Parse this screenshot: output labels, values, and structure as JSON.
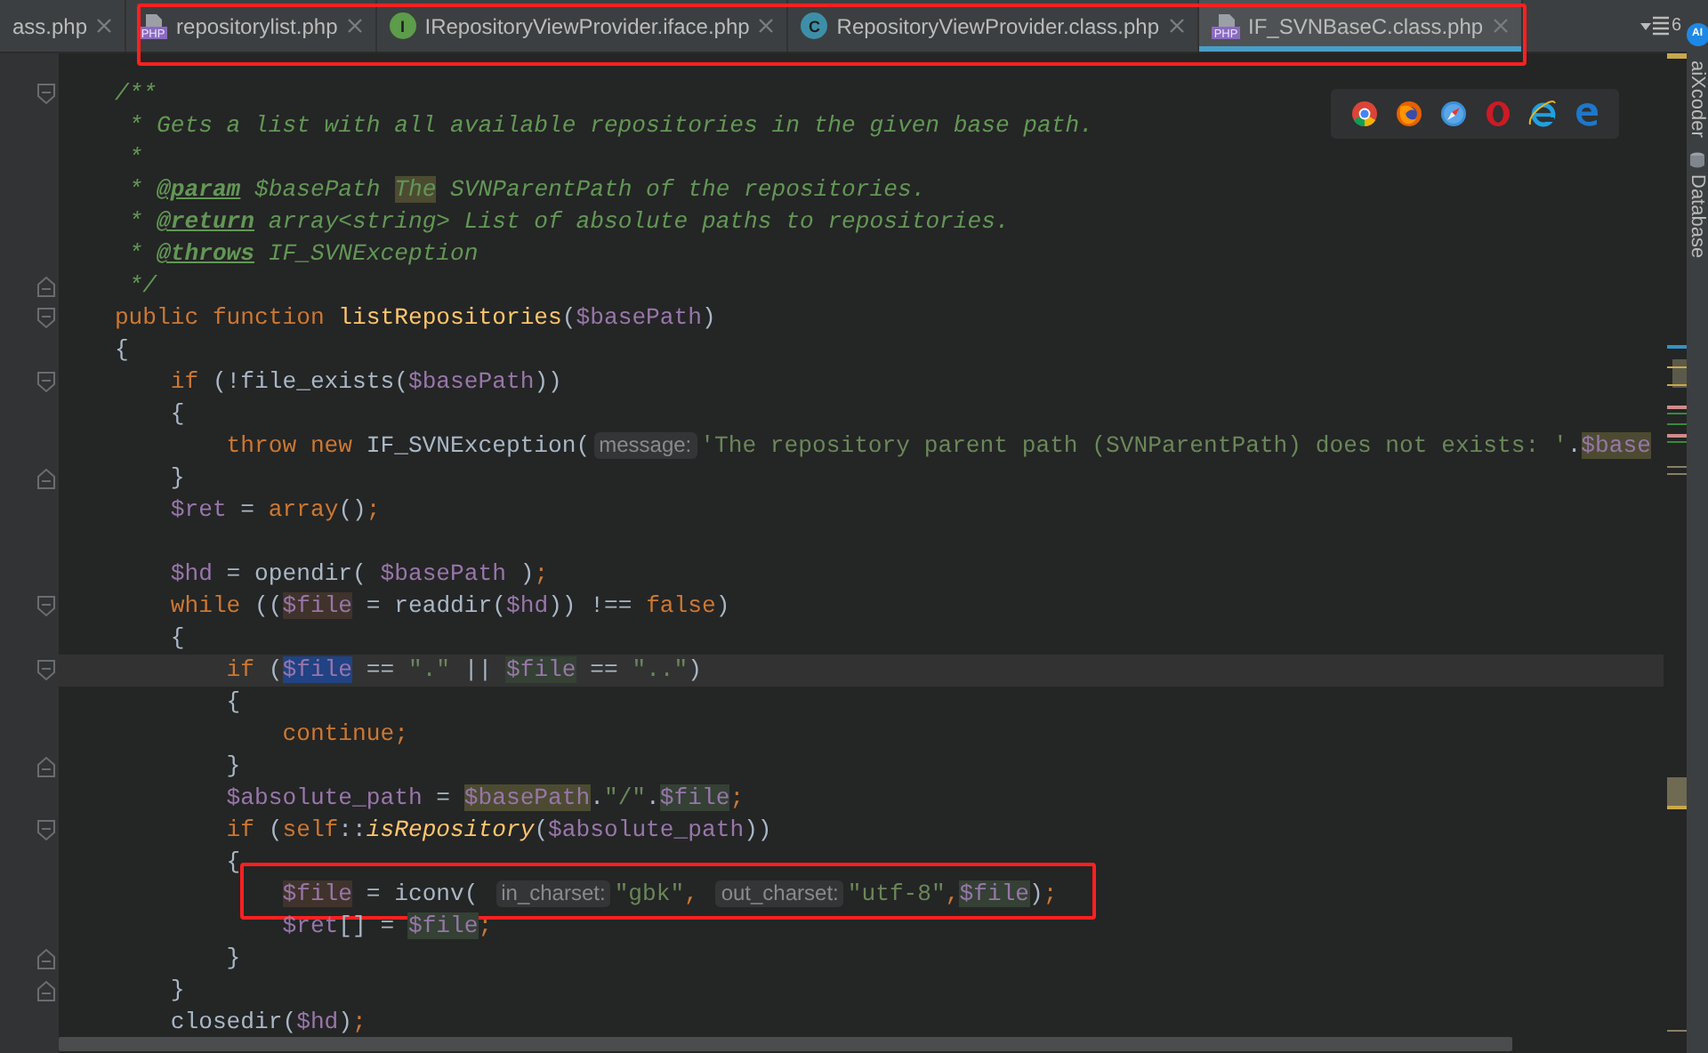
{
  "tab_bar": {
    "tabs": [
      {
        "label": "ass.php",
        "selected": false,
        "boxed": false
      },
      {
        "label": "repositorylist.php",
        "selected": false,
        "boxed": true,
        "icon": {
          "kind": "php-file",
          "label": "PHP"
        }
      },
      {
        "label": "IRepositoryViewProvider.iface.php",
        "selected": false,
        "boxed": true,
        "icon": {
          "kind": "interface",
          "label": "I"
        }
      },
      {
        "label": "RepositoryViewProvider.class.php",
        "selected": false,
        "boxed": true,
        "icon": {
          "kind": "class",
          "label": "C"
        }
      },
      {
        "label": "IF_SVNBaseC.class.php",
        "selected": true,
        "boxed": true,
        "icon": {
          "kind": "php-file",
          "label": "PHP"
        }
      }
    ],
    "overflow_count": "6"
  },
  "browser_bar": [
    {
      "kind": "chrome"
    },
    {
      "kind": "firefox"
    },
    {
      "kind": "safari"
    },
    {
      "kind": "opera"
    },
    {
      "kind": "ie"
    },
    {
      "kind": "edge"
    }
  ],
  "code_lines": [
    {
      "fold_start": true,
      "tokens": [
        {
          "kind": "doc",
          "text": "    /**"
        }
      ]
    },
    {
      "tokens": [
        {
          "kind": "doc",
          "text": "     * Gets a list with all available repositories in the given base path."
        }
      ]
    },
    {
      "tokens": [
        {
          "kind": "doc",
          "text": "     *"
        }
      ]
    },
    {
      "tokens": [
        {
          "kind": "doc",
          "text": "     * "
        },
        {
          "kind": "doctag",
          "text": "@param"
        },
        {
          "kind": "doc",
          "text": " $basePath "
        },
        {
          "kind": "doc-typo",
          "text": "The"
        },
        {
          "kind": "doc",
          "text": " SVNParentPath of the repositories."
        }
      ]
    },
    {
      "tokens": [
        {
          "kind": "doc",
          "text": "     * "
        },
        {
          "kind": "doctag",
          "text": "@return"
        },
        {
          "kind": "doc",
          "text": " array<string> List of absolute paths to repositories."
        }
      ]
    },
    {
      "tokens": [
        {
          "kind": "doc",
          "text": "     * "
        },
        {
          "kind": "doctag",
          "text": "@throws"
        },
        {
          "kind": "doc",
          "text": " IF_SVNException"
        }
      ]
    },
    {
      "fold_end": true,
      "tokens": [
        {
          "kind": "doc",
          "text": "     */"
        }
      ]
    },
    {
      "fold_start": true,
      "tokens": [
        {
          "kind": "kw",
          "text": "    public function "
        },
        {
          "kind": "fn",
          "text": "listRepositories"
        },
        {
          "kind": "plain",
          "text": "("
        },
        {
          "kind": "var",
          "text": "$basePath"
        },
        {
          "kind": "plain",
          "text": ")"
        }
      ]
    },
    {
      "tokens": [
        {
          "kind": "plain",
          "text": "    {"
        }
      ]
    },
    {
      "fold_start": true,
      "tokens": [
        {
          "kind": "kw",
          "text": "        if"
        },
        {
          "kind": "plain",
          "text": " (!file_exists("
        },
        {
          "kind": "var",
          "text": "$basePath"
        },
        {
          "kind": "plain",
          "text": "))"
        }
      ]
    },
    {
      "tokens": [
        {
          "kind": "plain",
          "text": "        {"
        }
      ]
    },
    {
      "tokens": [
        {
          "kind": "kw",
          "text": "            throw new "
        },
        {
          "kind": "plain",
          "text": "IF_SVNException("
        },
        {
          "kind": "hint",
          "text": "message:"
        },
        {
          "kind": "str",
          "text": "'The repository parent path (SVNParentPath) does not exists: '"
        },
        {
          "kind": "plain",
          "text": "."
        },
        {
          "kind": "var-search",
          "text": "$base"
        }
      ]
    },
    {
      "fold_end": true,
      "tokens": [
        {
          "kind": "plain",
          "text": "        }"
        }
      ]
    },
    {
      "tokens": [
        {
          "kind": "var",
          "text": "        $ret"
        },
        {
          "kind": "plain",
          "text": " = "
        },
        {
          "kind": "kw",
          "text": "array"
        },
        {
          "kind": "plain",
          "text": "()"
        },
        {
          "kind": "kw",
          "text": ";"
        }
      ]
    },
    {
      "blank": true
    },
    {
      "tokens": [
        {
          "kind": "var",
          "text": "        $hd"
        },
        {
          "kind": "plain",
          "text": " = opendir( "
        },
        {
          "kind": "var",
          "text": "$basePath"
        },
        {
          "kind": "plain",
          "text": " )"
        },
        {
          "kind": "kw",
          "text": ";"
        }
      ]
    },
    {
      "fold_start": true,
      "tokens": [
        {
          "kind": "kw",
          "text": "        while"
        },
        {
          "kind": "plain",
          "text": " (("
        },
        {
          "kind": "var-write",
          "text": "$file"
        },
        {
          "kind": "plain",
          "text": " = readdir("
        },
        {
          "kind": "var",
          "text": "$hd"
        },
        {
          "kind": "plain",
          "text": ")) !== "
        },
        {
          "kind": "kw",
          "text": "false"
        },
        {
          "kind": "plain",
          "text": ")"
        }
      ]
    },
    {
      "tokens": [
        {
          "kind": "plain",
          "text": "        {"
        }
      ]
    },
    {
      "fold_start": true,
      "current": true,
      "tokens": [
        {
          "kind": "kw",
          "text": "            if"
        },
        {
          "kind": "plain",
          "text": " ("
        },
        {
          "kind": "var-caret",
          "text": "$file"
        },
        {
          "kind": "plain",
          "text": " == "
        },
        {
          "kind": "str",
          "text": "\".\""
        },
        {
          "kind": "plain",
          "text": " || "
        },
        {
          "kind": "var-read",
          "text": "$file"
        },
        {
          "kind": "plain",
          "text": " == "
        },
        {
          "kind": "str",
          "text": "\"..\""
        },
        {
          "kind": "plain",
          "text": ")"
        }
      ]
    },
    {
      "tokens": [
        {
          "kind": "plain",
          "text": "            {"
        }
      ]
    },
    {
      "tokens": [
        {
          "kind": "kw",
          "text": "                continue;"
        }
      ]
    },
    {
      "fold_end": true,
      "tokens": [
        {
          "kind": "plain",
          "text": "            }"
        }
      ]
    },
    {
      "tokens": [
        {
          "kind": "var",
          "text": "            $absolute_path"
        },
        {
          "kind": "plain",
          "text": " = "
        },
        {
          "kind": "var-search",
          "text": "$basePath"
        },
        {
          "kind": "plain",
          "text": "."
        },
        {
          "kind": "str",
          "text": "\"/\""
        },
        {
          "kind": "plain",
          "text": "."
        },
        {
          "kind": "var-read",
          "text": "$file"
        },
        {
          "kind": "kw",
          "text": ";"
        }
      ]
    },
    {
      "fold_start": true,
      "tokens": [
        {
          "kind": "kw",
          "text": "            if"
        },
        {
          "kind": "plain",
          "text": " ("
        },
        {
          "kind": "kw",
          "text": "self"
        },
        {
          "kind": "plain",
          "text": "::"
        },
        {
          "kind": "static",
          "text": "isRepository"
        },
        {
          "kind": "plain",
          "text": "("
        },
        {
          "kind": "var",
          "text": "$absolute_path"
        },
        {
          "kind": "plain",
          "text": "))"
        }
      ]
    },
    {
      "tokens": [
        {
          "kind": "plain",
          "text": "            {"
        }
      ]
    },
    {
      "boxed": true,
      "tokens": [
        {
          "kind": "var-write",
          "text": "                $file"
        },
        {
          "kind": "plain",
          "text": " = iconv( "
        },
        {
          "kind": "hint",
          "text": "in_charset:"
        },
        {
          "kind": "str",
          "text": "\"gbk\""
        },
        {
          "kind": "kw",
          "text": ", "
        },
        {
          "kind": "hint",
          "text": "out_charset:"
        },
        {
          "kind": "str",
          "text": "\"utf-8\""
        },
        {
          "kind": "kw",
          "text": ","
        },
        {
          "kind": "var-read",
          "text": "$file"
        },
        {
          "kind": "plain",
          "text": ")"
        },
        {
          "kind": "kw",
          "text": ";"
        }
      ]
    },
    {
      "tokens": [
        {
          "kind": "var",
          "text": "                $ret"
        },
        {
          "kind": "plain",
          "text": "[] = "
        },
        {
          "kind": "var-read",
          "text": "$file"
        },
        {
          "kind": "kw",
          "text": ";"
        }
      ]
    },
    {
      "fold_end": true,
      "tokens": [
        {
          "kind": "plain",
          "text": "            }"
        }
      ]
    },
    {
      "fold_end": true,
      "tokens": [
        {
          "kind": "plain",
          "text": "        }"
        }
      ]
    },
    {
      "tokens": [
        {
          "kind": "plain",
          "text": "        closedir("
        },
        {
          "kind": "var",
          "text": "$hd"
        },
        {
          "kind": "plain",
          "text": ")"
        },
        {
          "kind": "kw",
          "text": ";"
        }
      ]
    }
  ],
  "tool_strip": {
    "badge": "AI",
    "items": [
      {
        "label": "aiXcoder",
        "kind": "plugin"
      },
      {
        "label": "Database",
        "kind": "database"
      }
    ]
  }
}
